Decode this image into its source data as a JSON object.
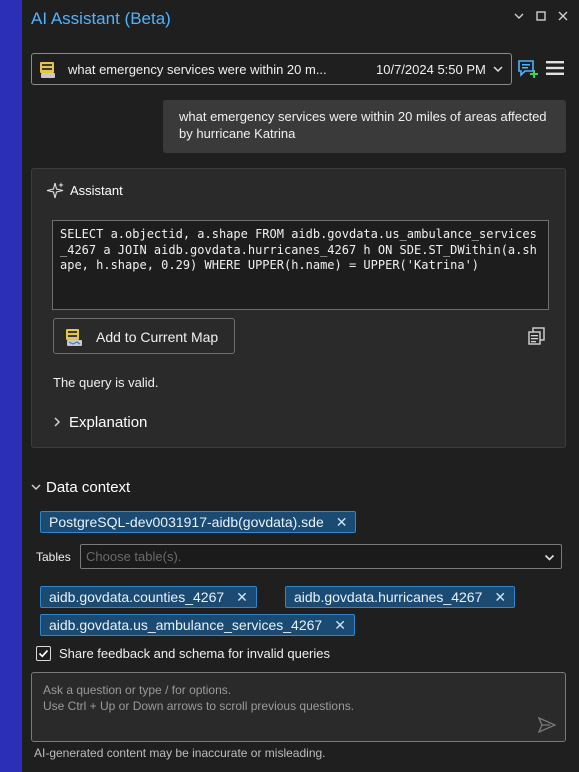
{
  "window": {
    "title": "AI Assistant (Beta)",
    "controls": [
      "chevron-down-icon",
      "maximize-icon",
      "close-icon"
    ]
  },
  "conversation": {
    "title": "what emergency services were within 20 m...",
    "datetime": "10/7/2024 5:50 PM",
    "icons": [
      "sql-database-icon",
      "chevron-down-icon",
      "new-chat-icon",
      "hamburger-menu-icon"
    ]
  },
  "user_message": {
    "text": "what emergency services were within 20 miles of areas affected by hurricane Katrina"
  },
  "assistant": {
    "label": "Assistant",
    "code": "SELECT a.objectid, a.shape FROM aidb.govdata.us_ambulance_services_4267 a JOIN aidb.govdata.hurricanes_4267 h ON SDE.ST_DWithin(a.shape, h.shape, 0.29) WHERE UPPER(h.name) = UPPER('Katrina')",
    "add_to_map_label": "Add to Current Map",
    "status": "The query is valid.",
    "explanation_label": "Explanation"
  },
  "data_context": {
    "header": "Data context",
    "connection": "PostgreSQL-dev0031917-aidb(govdata).sde",
    "tables_label": "Tables",
    "tables_placeholder": "Choose table(s).",
    "tables": [
      "aidb.govdata.counties_4267",
      "aidb.govdata.hurricanes_4267",
      "aidb.govdata.us_ambulance_services_4267"
    ],
    "share_feedback_label": "Share feedback and schema for invalid queries",
    "share_feedback_checked": true
  },
  "prompt": {
    "placeholder_line1": "Ask a question or type / for options.",
    "placeholder_line2": "Use Ctrl + Up or Down arrows to scroll previous questions."
  },
  "disclaimer": "AI-generated content may be inaccurate or misleading.",
  "colors": {
    "accent": "#4fb3ff",
    "chip_bg": "#1b4a72",
    "chip_border": "#2e86cf",
    "panel_bg": "#1f1f1f",
    "card_bg": "#2a2a2a",
    "outer_bg": "#2b2fb8"
  }
}
